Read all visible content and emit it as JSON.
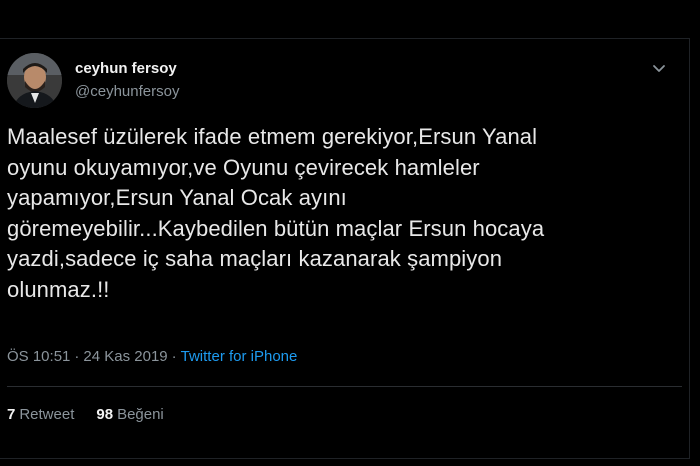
{
  "tweet": {
    "display_name": "ceyhun fersoy",
    "handle": "@ceyhunfersoy",
    "text": "Maalesef üzülerek ifade etmem gerekiyor,Ersun Yanal\noyunu okuyamıyor,ve Oyunu çevirecek hamleler\nyapamıyor,Ersun Yanal Ocak ayını\ngöremeyebilir...Kaybedilen bütün maçlar Ersun hocaya\nyazdi,sadece iç saha maçları kazanarak şampiyon\nolunmaz.!!",
    "time": "ÖS 10:51",
    "separator": "·",
    "date": "24 Kas 2019",
    "source": "Twitter for iPhone",
    "retweet_count": "7",
    "retweet_label": "Retweet",
    "like_count": "98",
    "like_label": "Beğeni",
    "icons": {
      "menu": "chevron-down-icon",
      "avatar": "profile-photo"
    },
    "colors": {
      "background": "#000000",
      "link": "#1d9bf0",
      "secondary_text": "#8b949b"
    }
  }
}
